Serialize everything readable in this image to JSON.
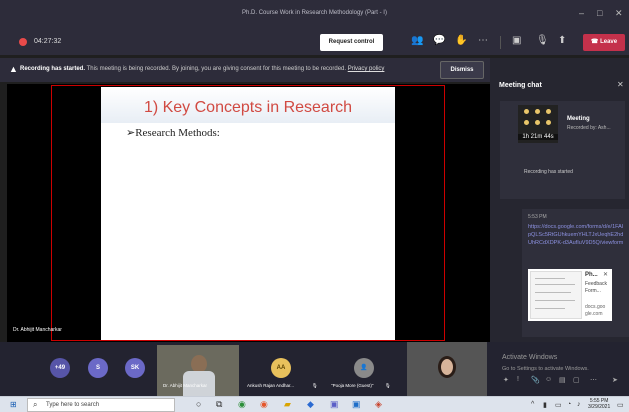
{
  "window": {
    "title": "Ph.D. Course Work in Research Methodology (Part - I)"
  },
  "toolbar": {
    "timer": "04:27:32",
    "request_control_label": "Request control",
    "leave_label": "Leave"
  },
  "banner": {
    "bold": "Recording has started.",
    "message": " This meeting is being recorded. By joining, you are giving consent for this meeting to be recorded. ",
    "link": "Privacy policy",
    "dismiss_label": "Dismiss"
  },
  "slide": {
    "title": "1) Key Concepts in Research",
    "bullet": "➢Research Methods:"
  },
  "presenter": {
    "name": "Dr. Abhijit Mancharkar"
  },
  "chat": {
    "title": "Meeting chat",
    "recording_card": {
      "title": "Meeting",
      "by": "Recorded by: Ash...",
      "duration": "1h 21m 44s",
      "status": "Recording has started"
    },
    "message": {
      "time": "5:53 PM",
      "link": "https://docs.google.com/forms/d/e/1FAIpQLSc5RtGUhkuemYHLTJxUeqhE2hdUhRCdXDPK-d3AufIuV9D5Q/viewform",
      "preview_title": "Ph...",
      "preview_sub": "Feedback Form...",
      "preview_url": "docs.goo gle.com"
    }
  },
  "participants": {
    "overflow": "+49",
    "avatars": [
      {
        "initials": "S",
        "color": "#6b69c7"
      },
      {
        "initials": "SK",
        "color": "#6b69c7"
      },
      {
        "initials": "AA",
        "color": "#e8c15c"
      }
    ],
    "video_label": "Dr. Abhijit Mancharkar",
    "aa_label": "Ankush Rajan Andhar...",
    "pooja_label": "\"Pooja More (Guest)\"",
    "obscured_text": "Activate Windows",
    "activate_sub": "Go to Settings to activate Windows."
  },
  "taskbar": {
    "search_placeholder": "Type here to search",
    "time": "5:55 PM",
    "date": "3/29/2021"
  },
  "colors": {
    "leave": "#c4314b",
    "accent": "#6b69c7",
    "slide_title": "#d14a42",
    "share_border": "#cc0000"
  }
}
